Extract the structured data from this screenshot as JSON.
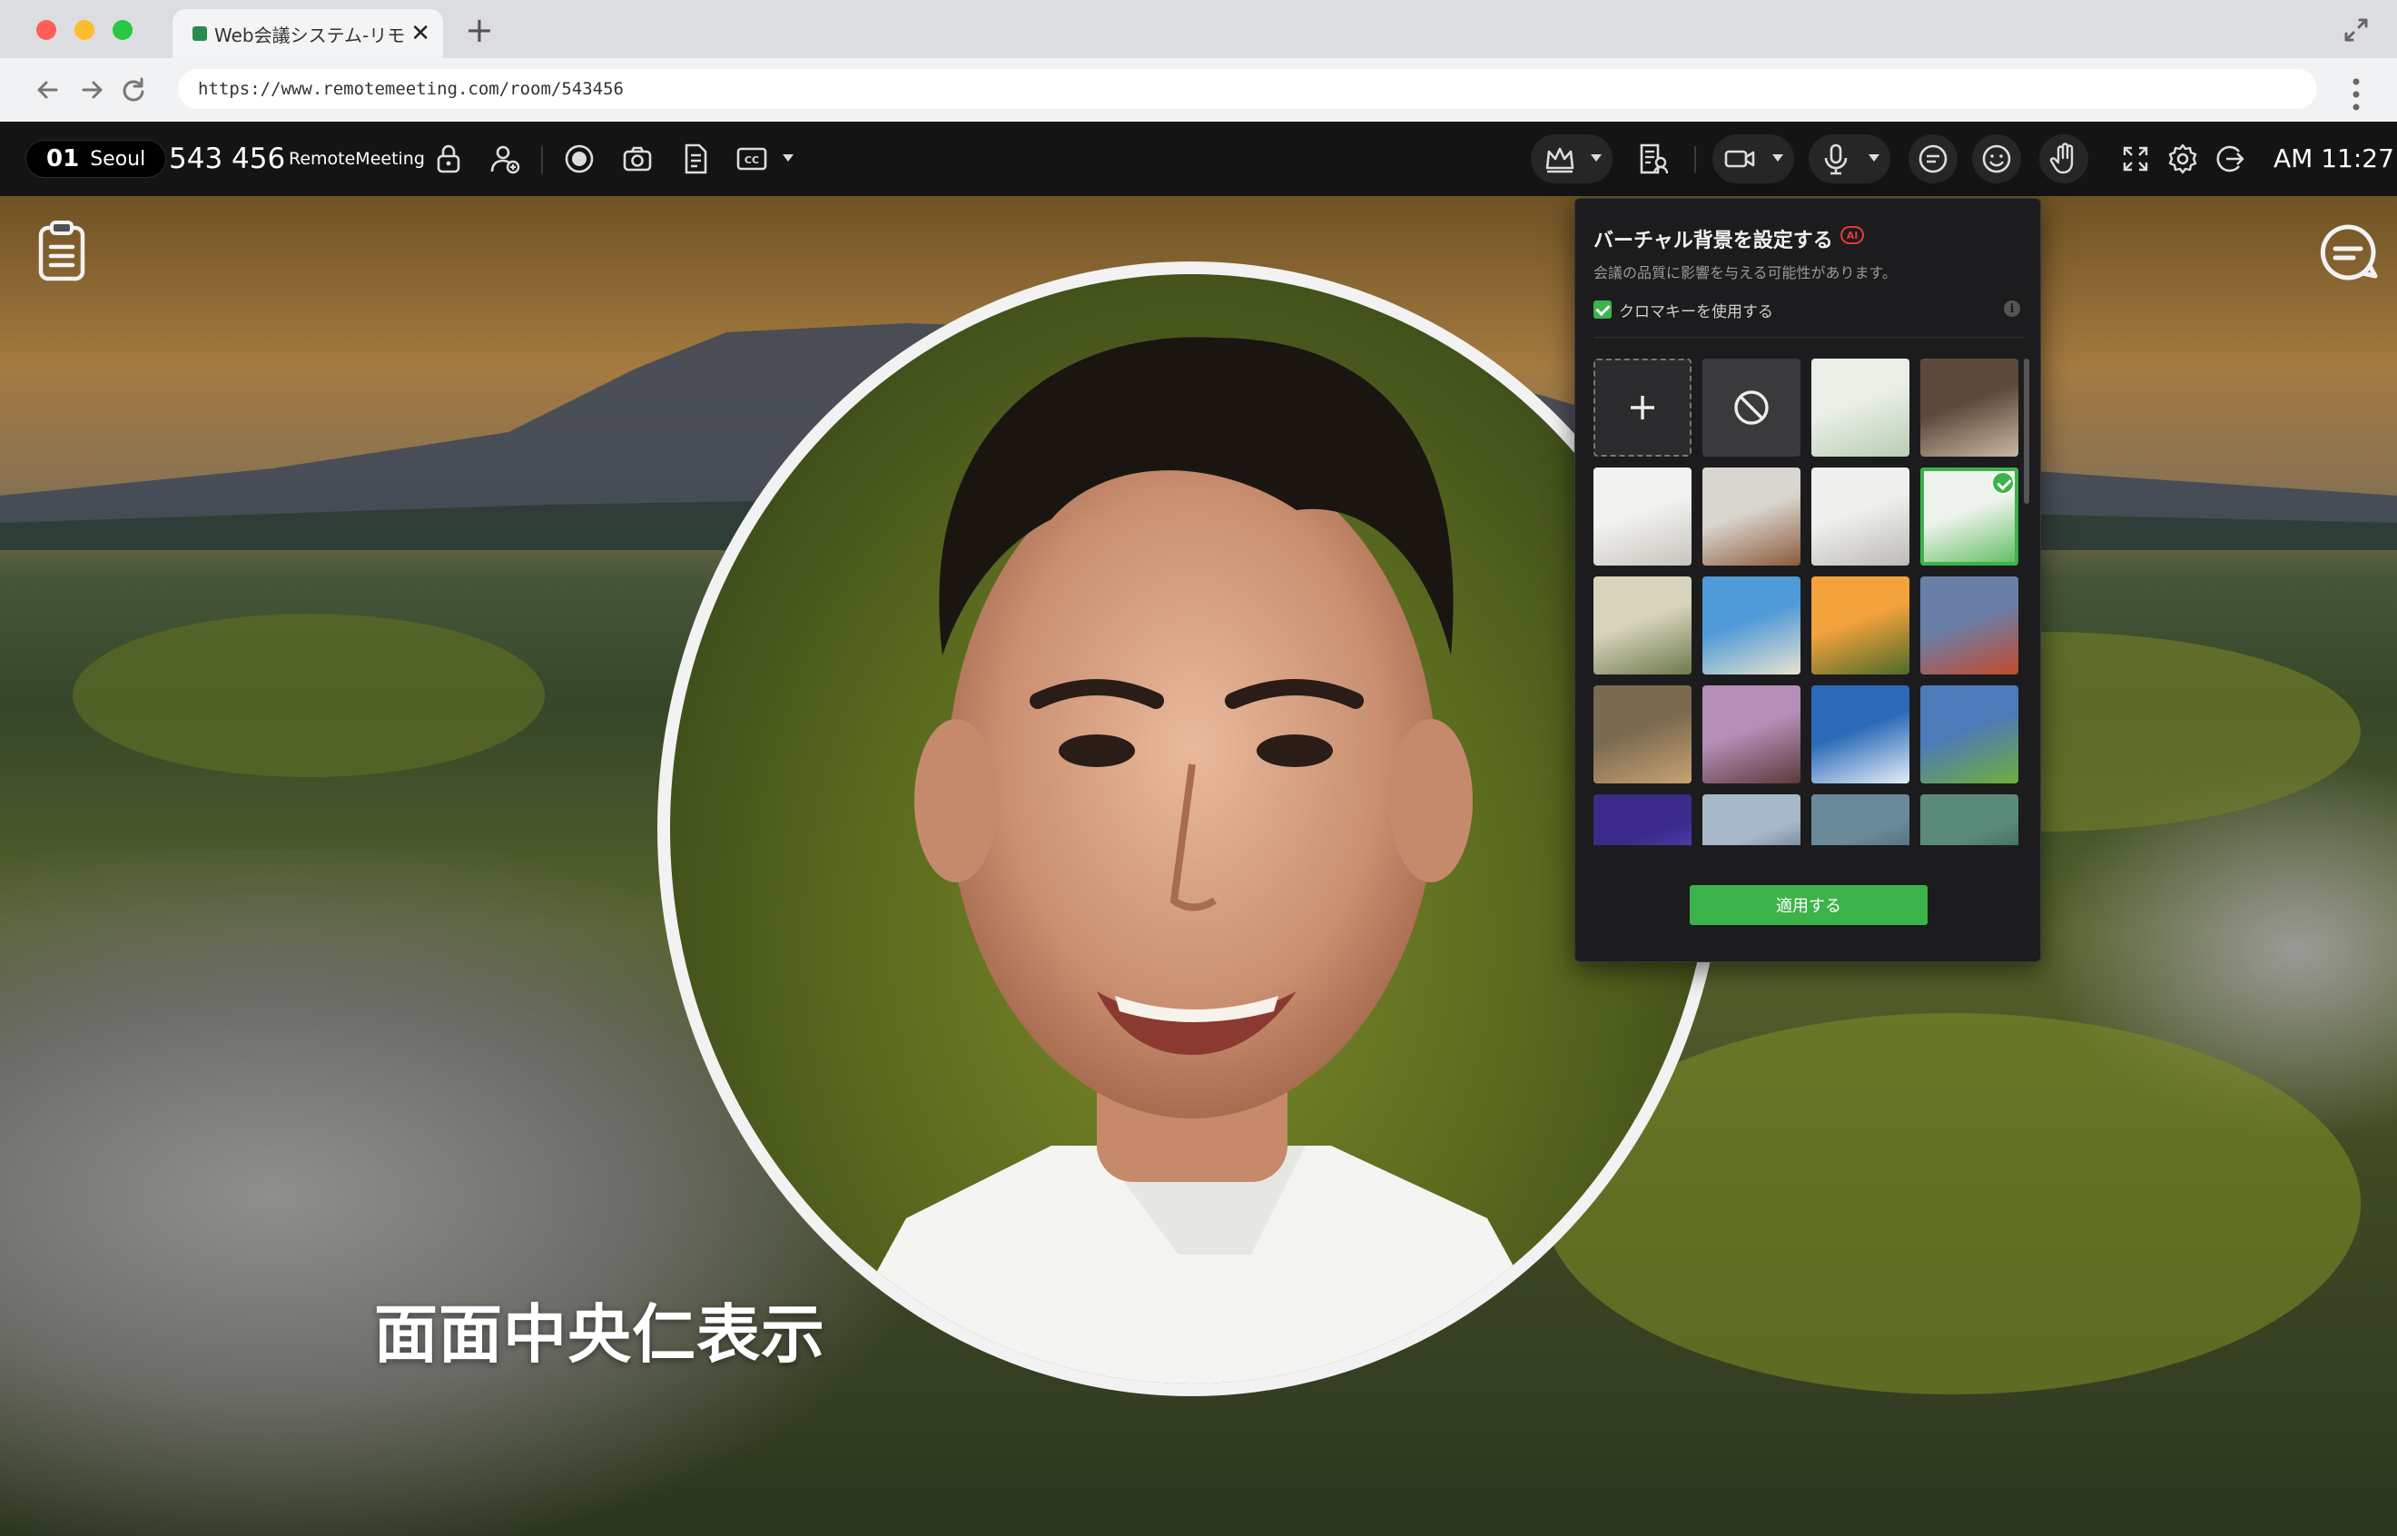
{
  "browser": {
    "tab_title": "Web会議システム-リモ...",
    "tab_close": "✕",
    "new_tab": "+",
    "url": "https://www.remotemeeting.com/room/543456"
  },
  "toolbar": {
    "room_number": "01",
    "room_city": "Seoul",
    "room_id": "543 456",
    "brand": "RemoteMeeting",
    "clock": "AM 11:27",
    "icons": [
      "lock-icon",
      "user-add-icon",
      "record-icon",
      "camera-icon",
      "document-icon",
      "cc-icon",
      "crown-icon",
      "presenter-icon",
      "video-camera-icon",
      "microphone-icon",
      "chat-icon",
      "emoji-icon",
      "raise-hand-icon",
      "fullscreen-icon",
      "gear-icon",
      "exit-icon"
    ]
  },
  "stage": {
    "caption": "面面中央仁表示"
  },
  "virtual_background": {
    "title": "バーチャル背景を設定する",
    "ai_badge": "AI",
    "subtitle": "会議の品質に影響を与える可能性があります。",
    "chroma_key_label": "クロマキーを使用する",
    "chroma_key_checked": true,
    "info": "i",
    "apply_label": "適用する",
    "accent_color": "#3cb34a",
    "thumbnails": [
      {
        "kind": "add"
      },
      {
        "kind": "none"
      },
      {
        "kind": "image",
        "c1": "#e9efe6",
        "c2": "#b9cdb4"
      },
      {
        "kind": "image",
        "c1": "#5b4a3c",
        "c2": "#c9b8a2"
      },
      {
        "kind": "image",
        "c1": "#f2f2f0",
        "c2": "#c8c4bc"
      },
      {
        "kind": "image",
        "c1": "#d9d6d0",
        "c2": "#8c5a3a"
      },
      {
        "kind": "image",
        "c1": "#efefed",
        "c2": "#bdbab4"
      },
      {
        "kind": "image",
        "c1": "#eef2ec",
        "c2": "#5bbd5e",
        "selected": true
      },
      {
        "kind": "image",
        "c1": "#d8d4bc",
        "c2": "#6d7a4c"
      },
      {
        "kind": "image",
        "c1": "#4f9ad8",
        "c2": "#e9e3d0"
      },
      {
        "kind": "image",
        "c1": "#f3a23c",
        "c2": "#4d6a2a"
      },
      {
        "kind": "image",
        "c1": "#6a7fa8",
        "c2": "#c24a2c"
      },
      {
        "kind": "image",
        "c1": "#7a6a50",
        "c2": "#c9a272"
      },
      {
        "kind": "image",
        "c1": "#b58fb8",
        "c2": "#5b3a3a"
      },
      {
        "kind": "image",
        "c1": "#2a6ab8",
        "c2": "#e6eef7"
      },
      {
        "kind": "image",
        "c1": "#4d7ab8",
        "c2": "#6fae3c"
      },
      {
        "kind": "image",
        "c1": "#3b2a8a",
        "c2": "#6a5ad8"
      },
      {
        "kind": "image",
        "c1": "#a8b8c8",
        "c2": "#2e4a6a"
      },
      {
        "kind": "image",
        "c1": "#6a8a9a",
        "c2": "#2d4c5c"
      },
      {
        "kind": "image",
        "c1": "#5a8a7a",
        "c2": "#1f4a3e"
      }
    ]
  }
}
